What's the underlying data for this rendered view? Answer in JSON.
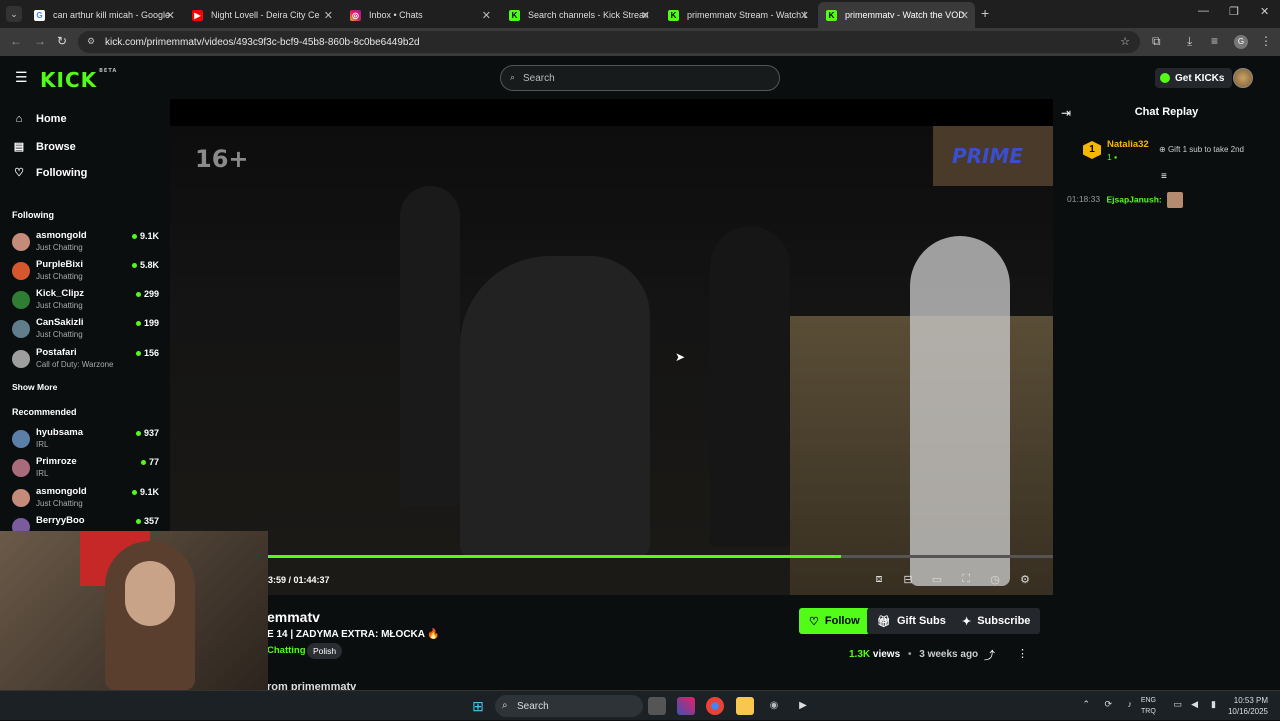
{
  "browser": {
    "tabs": [
      {
        "title": "can arthur kill micah - Google S",
        "icon": "google-icon"
      },
      {
        "title": "Night Lovell - Deira City Ce",
        "icon": "youtube-icon"
      },
      {
        "title": "Inbox • Chats",
        "icon": "instagram-icon"
      },
      {
        "title": "Search channels - Kick Streamin",
        "icon": "kick-icon"
      },
      {
        "title": "primemmatv Stream - Watch L",
        "icon": "kick-icon"
      },
      {
        "title": "primemmatv - Watch the VOD",
        "icon": "kick-icon",
        "active": true
      }
    ],
    "url": "kick.com/primemmatv/videos/493c9f3c-bcf9-45b8-860b-8c0be6449b2d"
  },
  "header": {
    "logo": "KICK",
    "logo_badge": "BETA",
    "search_placeholder": "Search",
    "get_kicks_label": "Get KICKs"
  },
  "sidebar": {
    "nav": [
      {
        "label": "Home",
        "icon": "home-icon"
      },
      {
        "label": "Browse",
        "icon": "browse-icon"
      },
      {
        "label": "Following",
        "icon": "heart-icon"
      }
    ],
    "following_heading": "Following",
    "following": [
      {
        "name": "asmongold",
        "category": "Just Chatting",
        "viewers": "9.1K",
        "color": "#c48a7a"
      },
      {
        "name": "PurpleBixi",
        "category": "Just Chatting",
        "viewers": "5.8K",
        "color": "#d4572e"
      },
      {
        "name": "Kick_Clipz",
        "category": "Just Chatting",
        "viewers": "299",
        "color": "#2e7d32"
      },
      {
        "name": "CanSakizli",
        "category": "Just Chatting",
        "viewers": "199",
        "color": "#607d8b"
      },
      {
        "name": "Postafari",
        "category": "Call of Duty: Warzone",
        "viewers": "156",
        "color": "#9e9e9e"
      }
    ],
    "show_more": "Show More",
    "recommended_heading": "Recommended",
    "recommended": [
      {
        "name": "hyubsama",
        "category": "IRL",
        "viewers": "937",
        "color": "#5c7fa8"
      },
      {
        "name": "Primroze",
        "category": "IRL",
        "viewers": "77",
        "color": "#a86b7c"
      },
      {
        "name": "asmongold",
        "category": "Just Chatting",
        "viewers": "9.1K",
        "color": "#c48a7a"
      },
      {
        "name": "BerryyBoo",
        "category": "",
        "viewers": "357",
        "color": "#7a5c9e"
      }
    ]
  },
  "video": {
    "rating": "16+",
    "watermark": "PRIME",
    "timecode": "3:59 / 01:44:37",
    "progress": 0.73
  },
  "vod": {
    "streamer": "emmatv",
    "title": "E 14 | ZADYMA EXTRA: MŁOCKA 🔥",
    "category": "Chatting",
    "language": "Polish",
    "follow_label": "Follow",
    "gift_label": "Gift Subs",
    "subscribe_label": "Subscribe",
    "views": "1.3K",
    "views_word": "views",
    "ago": "3 weeks ago",
    "partial_text": "rom primemmatv"
  },
  "chat": {
    "title": "Chat Replay",
    "top_gifter": {
      "rank": "1",
      "name": "Natalia32",
      "count": "1"
    },
    "gift_hint": "Gift 1 sub to take 2nd",
    "message": {
      "time": "01:18:33",
      "user": "EjsapJanush:"
    }
  },
  "taskbar": {
    "search_placeholder": "Search",
    "lang_line1": "ENG",
    "lang_line2": "TRQ",
    "time": "10:53 PM",
    "date": "10/16/2025"
  },
  "colors": {
    "accent": "#53fc18",
    "gold": "#f5b800",
    "bg": "#0b0e0f"
  }
}
